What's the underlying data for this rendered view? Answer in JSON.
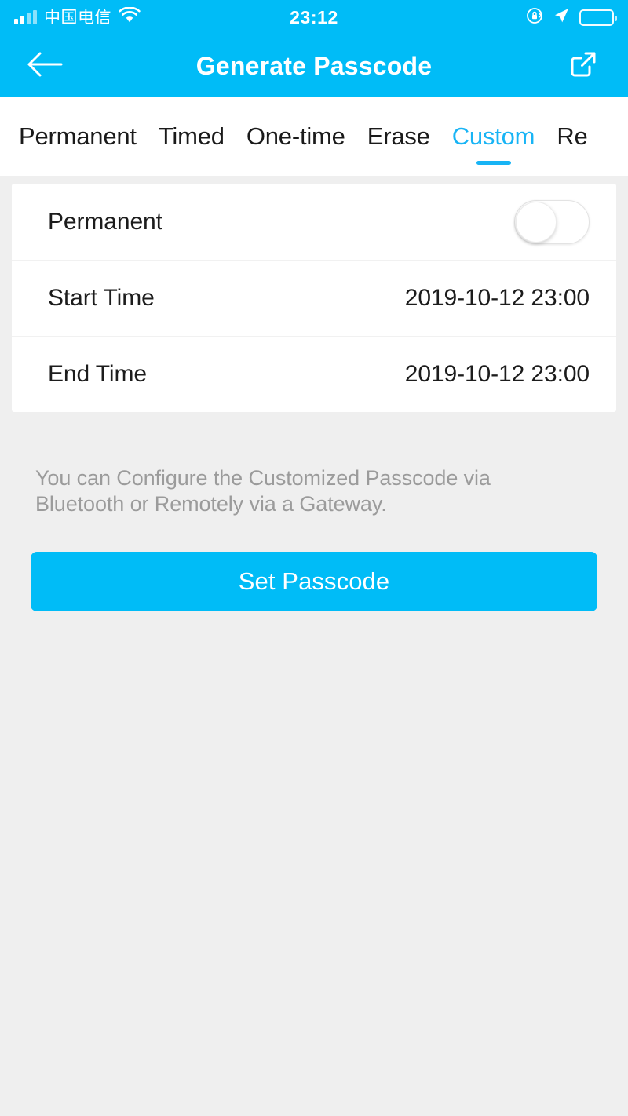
{
  "status_bar": {
    "carrier": "中国电信",
    "time": "23:12",
    "signal_icon": "signal-bars-icon",
    "wifi_icon": "wifi-icon",
    "rotation_lock_icon": "rotation-lock-icon",
    "location_icon": "location-arrow-icon",
    "battery_icon": "battery-full-icon",
    "battery_level": 100
  },
  "nav": {
    "title": "Generate Passcode",
    "back_icon": "back-arrow-icon",
    "share_icon": "share-external-link-icon"
  },
  "tabs": {
    "active_index": 4,
    "items": [
      {
        "label": "Permanent"
      },
      {
        "label": "Timed"
      },
      {
        "label": "One-time"
      },
      {
        "label": "Erase"
      },
      {
        "label": "Custom"
      },
      {
        "label": "Re"
      }
    ]
  },
  "form": {
    "rows": [
      {
        "label": "Permanent",
        "type": "toggle",
        "value": "off"
      },
      {
        "label": "Start Time",
        "type": "value",
        "value": "2019-10-12 23:00"
      },
      {
        "label": "End Time",
        "type": "value",
        "value": "2019-10-12 23:00"
      }
    ]
  },
  "description": "You can Configure the Customized Passcode via Bluetooth or Remotely via a Gateway.",
  "primary_button": {
    "label": "Set Passcode"
  },
  "colors": {
    "accent": "#00bcf7",
    "tab_active": "#18b4f5",
    "page_background": "#efefef",
    "card_background": "#ffffff",
    "text_primary": "#1c1c1c",
    "text_muted": "#9b9b9b"
  }
}
